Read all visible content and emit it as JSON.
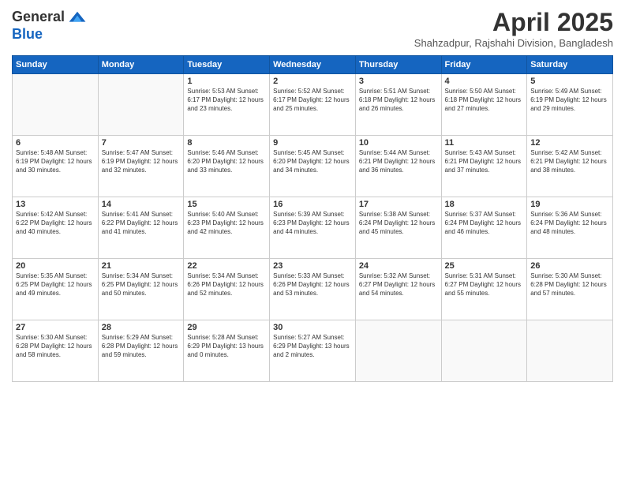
{
  "logo": {
    "line1": "General",
    "line2": "Blue"
  },
  "title": "April 2025",
  "subtitle": "Shahzadpur, Rajshahi Division, Bangladesh",
  "days_of_week": [
    "Sunday",
    "Monday",
    "Tuesday",
    "Wednesday",
    "Thursday",
    "Friday",
    "Saturday"
  ],
  "weeks": [
    [
      {
        "day": "",
        "info": ""
      },
      {
        "day": "",
        "info": ""
      },
      {
        "day": "1",
        "info": "Sunrise: 5:53 AM\nSunset: 6:17 PM\nDaylight: 12 hours and 23 minutes."
      },
      {
        "day": "2",
        "info": "Sunrise: 5:52 AM\nSunset: 6:17 PM\nDaylight: 12 hours and 25 minutes."
      },
      {
        "day": "3",
        "info": "Sunrise: 5:51 AM\nSunset: 6:18 PM\nDaylight: 12 hours and 26 minutes."
      },
      {
        "day": "4",
        "info": "Sunrise: 5:50 AM\nSunset: 6:18 PM\nDaylight: 12 hours and 27 minutes."
      },
      {
        "day": "5",
        "info": "Sunrise: 5:49 AM\nSunset: 6:19 PM\nDaylight: 12 hours and 29 minutes."
      }
    ],
    [
      {
        "day": "6",
        "info": "Sunrise: 5:48 AM\nSunset: 6:19 PM\nDaylight: 12 hours and 30 minutes."
      },
      {
        "day": "7",
        "info": "Sunrise: 5:47 AM\nSunset: 6:19 PM\nDaylight: 12 hours and 32 minutes."
      },
      {
        "day": "8",
        "info": "Sunrise: 5:46 AM\nSunset: 6:20 PM\nDaylight: 12 hours and 33 minutes."
      },
      {
        "day": "9",
        "info": "Sunrise: 5:45 AM\nSunset: 6:20 PM\nDaylight: 12 hours and 34 minutes."
      },
      {
        "day": "10",
        "info": "Sunrise: 5:44 AM\nSunset: 6:21 PM\nDaylight: 12 hours and 36 minutes."
      },
      {
        "day": "11",
        "info": "Sunrise: 5:43 AM\nSunset: 6:21 PM\nDaylight: 12 hours and 37 minutes."
      },
      {
        "day": "12",
        "info": "Sunrise: 5:42 AM\nSunset: 6:21 PM\nDaylight: 12 hours and 38 minutes."
      }
    ],
    [
      {
        "day": "13",
        "info": "Sunrise: 5:42 AM\nSunset: 6:22 PM\nDaylight: 12 hours and 40 minutes."
      },
      {
        "day": "14",
        "info": "Sunrise: 5:41 AM\nSunset: 6:22 PM\nDaylight: 12 hours and 41 minutes."
      },
      {
        "day": "15",
        "info": "Sunrise: 5:40 AM\nSunset: 6:23 PM\nDaylight: 12 hours and 42 minutes."
      },
      {
        "day": "16",
        "info": "Sunrise: 5:39 AM\nSunset: 6:23 PM\nDaylight: 12 hours and 44 minutes."
      },
      {
        "day": "17",
        "info": "Sunrise: 5:38 AM\nSunset: 6:24 PM\nDaylight: 12 hours and 45 minutes."
      },
      {
        "day": "18",
        "info": "Sunrise: 5:37 AM\nSunset: 6:24 PM\nDaylight: 12 hours and 46 minutes."
      },
      {
        "day": "19",
        "info": "Sunrise: 5:36 AM\nSunset: 6:24 PM\nDaylight: 12 hours and 48 minutes."
      }
    ],
    [
      {
        "day": "20",
        "info": "Sunrise: 5:35 AM\nSunset: 6:25 PM\nDaylight: 12 hours and 49 minutes."
      },
      {
        "day": "21",
        "info": "Sunrise: 5:34 AM\nSunset: 6:25 PM\nDaylight: 12 hours and 50 minutes."
      },
      {
        "day": "22",
        "info": "Sunrise: 5:34 AM\nSunset: 6:26 PM\nDaylight: 12 hours and 52 minutes."
      },
      {
        "day": "23",
        "info": "Sunrise: 5:33 AM\nSunset: 6:26 PM\nDaylight: 12 hours and 53 minutes."
      },
      {
        "day": "24",
        "info": "Sunrise: 5:32 AM\nSunset: 6:27 PM\nDaylight: 12 hours and 54 minutes."
      },
      {
        "day": "25",
        "info": "Sunrise: 5:31 AM\nSunset: 6:27 PM\nDaylight: 12 hours and 55 minutes."
      },
      {
        "day": "26",
        "info": "Sunrise: 5:30 AM\nSunset: 6:28 PM\nDaylight: 12 hours and 57 minutes."
      }
    ],
    [
      {
        "day": "27",
        "info": "Sunrise: 5:30 AM\nSunset: 6:28 PM\nDaylight: 12 hours and 58 minutes."
      },
      {
        "day": "28",
        "info": "Sunrise: 5:29 AM\nSunset: 6:28 PM\nDaylight: 12 hours and 59 minutes."
      },
      {
        "day": "29",
        "info": "Sunrise: 5:28 AM\nSunset: 6:29 PM\nDaylight: 13 hours and 0 minutes."
      },
      {
        "day": "30",
        "info": "Sunrise: 5:27 AM\nSunset: 6:29 PM\nDaylight: 13 hours and 2 minutes."
      },
      {
        "day": "",
        "info": ""
      },
      {
        "day": "",
        "info": ""
      },
      {
        "day": "",
        "info": ""
      }
    ]
  ]
}
